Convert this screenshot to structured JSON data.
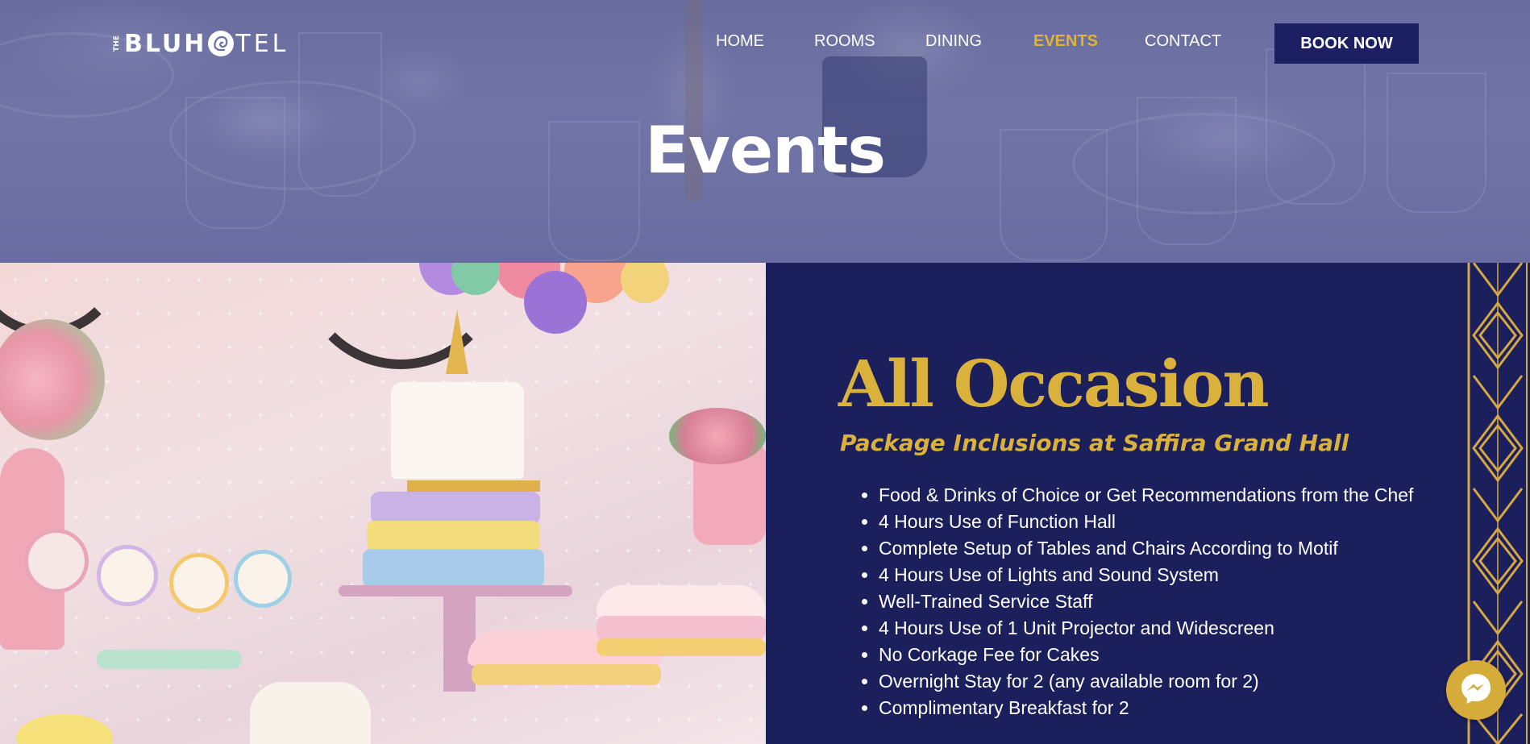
{
  "brand": {
    "logo_the": "THE",
    "logo_blu": "BLUH",
    "logo_tel": "TEL"
  },
  "nav": {
    "items": [
      {
        "label": "HOME",
        "active": false
      },
      {
        "label": "ROOMS",
        "active": false
      },
      {
        "label": "DINING",
        "active": false
      },
      {
        "label": "EVENTS",
        "active": true
      },
      {
        "label": "CONTACT",
        "active": false
      }
    ],
    "book_button": "BOOK NOW"
  },
  "hero": {
    "title": "Events"
  },
  "occasion": {
    "title": "All Occasion",
    "subtitle": "Package Inclusions at Saffira Grand Hall",
    "inclusions": [
      "Food & Drinks of Choice or Get Recommendations from the Chef",
      "4 Hours Use of Function Hall",
      "Complete Setup of Tables and Chairs According to Motif",
      "4 Hours Use of Lights and Sound System",
      "Well-Trained Service Staff",
      "4 Hours Use of 1 Unit Projector and Widescreen",
      "No Corkage Fee for Cakes",
      "Overnight Stay for 2 (any available room for 2)",
      "Complimentary Breakfast for 2"
    ]
  },
  "colors": {
    "navy": "#1b1f5c",
    "gold": "#d9b13b",
    "active_nav": "#e0b339",
    "white": "#ffffff"
  },
  "icons": {
    "chat": "messenger-icon",
    "logo_mark": "hotel-logo-icon",
    "list_marker": "bullet-icon"
  },
  "images": {
    "hero_background": "table-setting-photo",
    "event_photo": "unicorn-cake-party-photo"
  }
}
